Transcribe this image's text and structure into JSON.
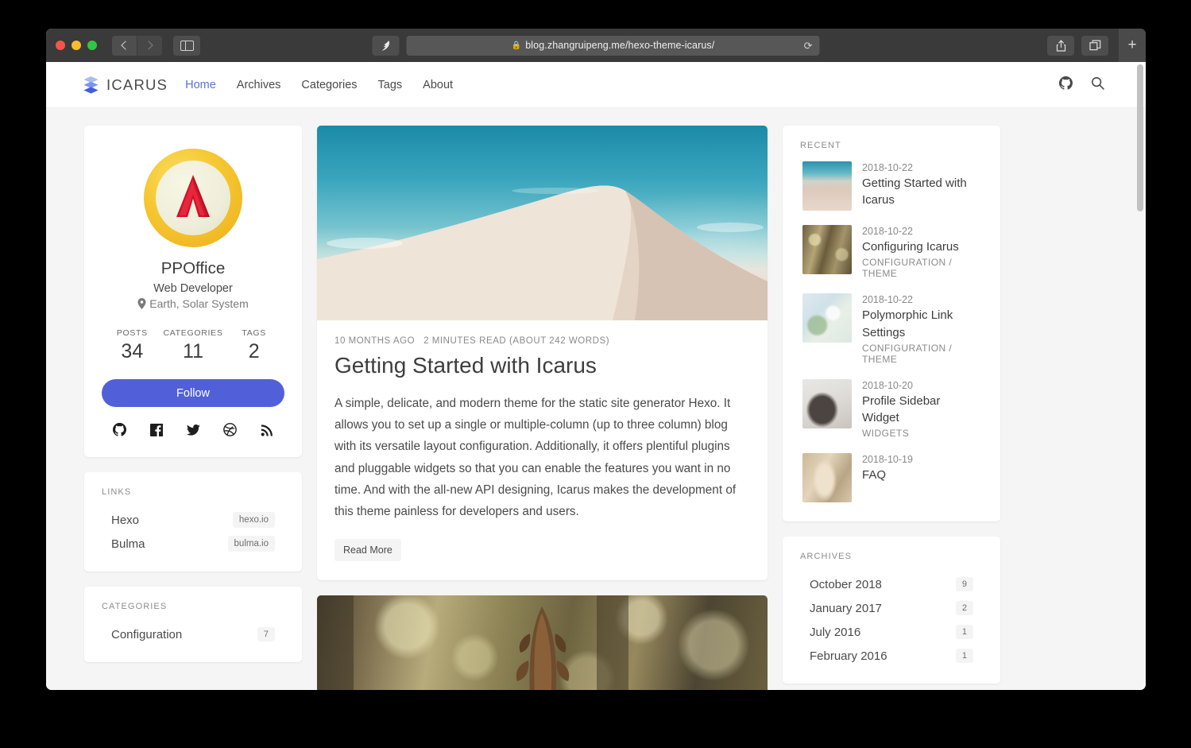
{
  "browser": {
    "url": "blog.zhangruipeng.me/hexo-theme-icarus/",
    "lock_icon": "lock-icon",
    "back_icon": "chevron-left-icon",
    "forward_icon": "chevron-right-icon",
    "sidebar_icon": "sidebar-toggle-icon",
    "reader_icon": "reader-bird-icon",
    "reload_icon": "reload-icon",
    "share_icon": "share-icon",
    "tabs_icon": "tab-overview-icon",
    "newtab_label": "+"
  },
  "sitenav": {
    "brand": "ICARUS",
    "brand_icon": "layers-logo-icon",
    "links": [
      {
        "label": "Home",
        "active": true
      },
      {
        "label": "Archives",
        "active": false
      },
      {
        "label": "Categories",
        "active": false
      },
      {
        "label": "Tags",
        "active": false
      },
      {
        "label": "About",
        "active": false
      }
    ],
    "github_icon": "github-icon",
    "search_icon": "search-icon"
  },
  "profile": {
    "avatar_icon": "spartan-lambda-shield-avatar",
    "name": "PPOffice",
    "title": "Web Developer",
    "location": "Earth, Solar System",
    "location_icon": "map-pin-icon",
    "stats": [
      {
        "label": "POSTS",
        "value": "34"
      },
      {
        "label": "CATEGORIES",
        "value": "11"
      },
      {
        "label": "TAGS",
        "value": "2"
      }
    ],
    "follow_label": "Follow",
    "follow_color": "#5160d9",
    "socials": [
      {
        "icon": "github-icon"
      },
      {
        "icon": "facebook-icon"
      },
      {
        "icon": "twitter-icon"
      },
      {
        "icon": "dribbble-icon"
      },
      {
        "icon": "rss-icon"
      }
    ]
  },
  "links_widget": {
    "title": "LINKS",
    "items": [
      {
        "name": "Hexo",
        "tag": "hexo.io"
      },
      {
        "name": "Bulma",
        "tag": "bulma.io"
      }
    ]
  },
  "categories_widget": {
    "title": "CATEGORIES",
    "items": [
      {
        "name": "Configuration",
        "count": "7"
      }
    ]
  },
  "articles": [
    {
      "hero_icon": "sand-dune-photo",
      "age": "10 MONTHS AGO",
      "readtime": "2 MINUTES READ (ABOUT 242 WORDS)",
      "title": "Getting Started with Icarus",
      "body": "A simple, delicate, and modern theme for the static site generator Hexo. It allows you to set up a single or multiple-column (up to three column) blog with its versatile layout configuration. Additionally, it offers plentiful plugins and pluggable widgets so that you can enable the features you want in no time. And with the all-new API designing, Icarus makes the development of this theme painless for developers and users.",
      "read_more": "Read More"
    },
    {
      "hero_icon": "pine-cone-photo"
    }
  ],
  "recent_widget": {
    "title": "RECENT",
    "items": [
      {
        "thumb": "sand-dune-thumb",
        "date": "2018-10-22",
        "title": "Getting Started with Icarus",
        "categories": ""
      },
      {
        "thumb": "pine-cone-thumb",
        "date": "2018-10-22",
        "title": "Configuring Icarus",
        "categories": "CONFIGURATION / THEME"
      },
      {
        "thumb": "white-flower-thumb",
        "date": "2018-10-22",
        "title": "Polymorphic Link Settings",
        "categories": "CONFIGURATION / THEME"
      },
      {
        "thumb": "deer-thumb",
        "date": "2018-10-20",
        "title": "Profile Sidebar Widget",
        "categories": "WIDGETS"
      },
      {
        "thumb": "statue-thumb",
        "date": "2018-10-19",
        "title": "FAQ",
        "categories": ""
      }
    ]
  },
  "archives_widget": {
    "title": "ARCHIVES",
    "items": [
      {
        "name": "October 2018",
        "count": "9"
      },
      {
        "name": "January 2017",
        "count": "2"
      },
      {
        "name": "July 2016",
        "count": "1"
      },
      {
        "name": "February 2016",
        "count": "1"
      }
    ]
  }
}
